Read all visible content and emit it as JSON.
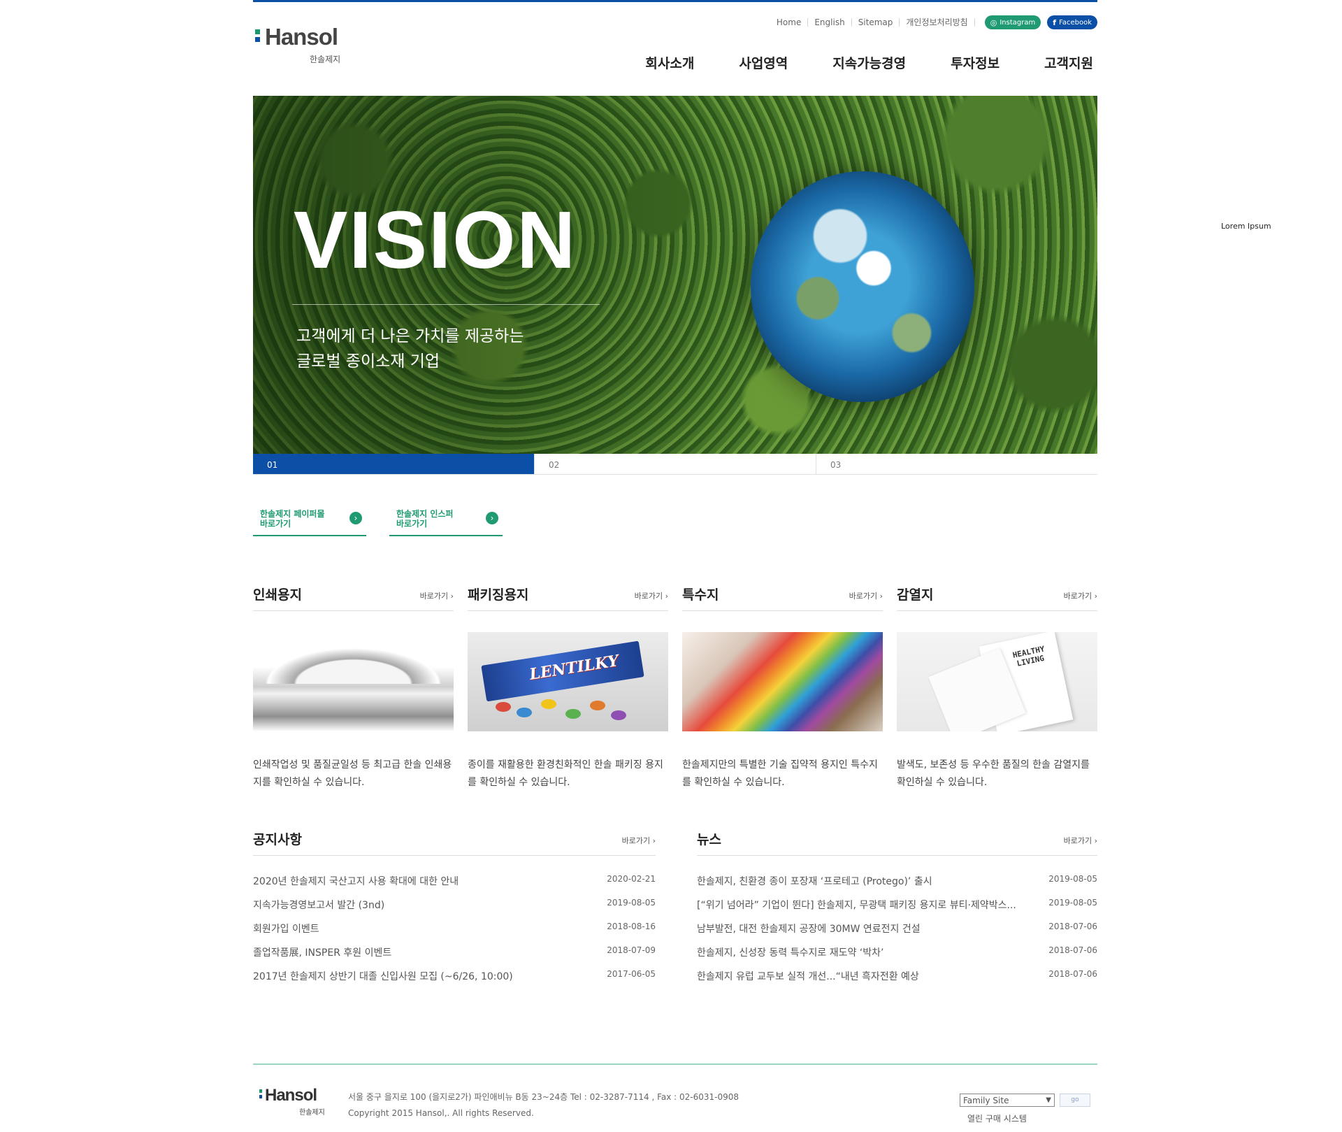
{
  "colors": {
    "brand_blue": "#0b4fa6",
    "brand_green": "#1f9a73",
    "instagram": "#1f9a73",
    "facebook": "#0b4fa6",
    "logo_green": "#1a9a6a",
    "logo_blue": "#0b4fa6"
  },
  "header": {
    "logo_word": "Hansol",
    "logo_sub": "한솔제지",
    "util_links": [
      "Home",
      "English",
      "Sitemap",
      "개인정보처리방침"
    ],
    "sns": {
      "instagram": "Instagram",
      "facebook": "Facebook",
      "instagram_icon": "instagram-icon",
      "facebook_icon": "facebook-icon"
    },
    "gnb": [
      "회사소개",
      "사업영역",
      "지속가능경영",
      "투자정보",
      "고객지원"
    ]
  },
  "hero": {
    "title": "VISION",
    "copy_line1": "고객에게 더 나은 가치를 제공하는",
    "copy_line2": "글로벌 종이소재 기업",
    "steps": [
      "01",
      "02",
      "03"
    ],
    "active_step": 1
  },
  "quick_links": [
    {
      "line1": "한솔제지 페이퍼몰",
      "line2": "바로가기",
      "icon": "arrow-right-icon"
    },
    {
      "line1": "한솔제지 인스퍼",
      "line2": "바로가기",
      "icon": "arrow-right-icon"
    }
  ],
  "products": [
    {
      "title": "인쇄용지",
      "more": "바로가기",
      "desc": "인쇄작업성 및 품질균일성 등 최고급 한솔 인쇄용지를 확인하실 수 있습니다."
    },
    {
      "title": "패키징용지",
      "more": "바로가기",
      "desc": "종이를 재활용한 환경친화적인 한솔 패키징 용지를 확인하실 수 있습니다.",
      "image_text": "LENTILKY"
    },
    {
      "title": "특수지",
      "more": "바로가기",
      "desc": "한솔제지만의 특별한 기술 집약적 용지인 특수지를 확인하실 수 있습니다."
    },
    {
      "title": "감열지",
      "more": "바로가기",
      "desc": "발색도, 보존성 등 우수한 품질의 한솔 감열지를 확인하실 수 있습니다.",
      "image_text": "HEALTHY LIVING"
    }
  ],
  "notice": {
    "title": "공지사항",
    "more": "바로가기",
    "items": [
      {
        "title": "2020년 한솔제지 국산고지 사용 확대에 대한 안내",
        "date": "2020-02-21"
      },
      {
        "title": "지속가능경영보고서 발간 (3nd)",
        "date": "2019-08-05"
      },
      {
        "title": "회원가입 이벤트",
        "date": "2018-08-16"
      },
      {
        "title": "졸업작품展, INSPER 후원 이벤트",
        "date": "2018-07-09"
      },
      {
        "title": "2017년 한솔제지 상반기 대졸 신입사원 모집 (~6/26, 10:00)",
        "date": "2017-06-05"
      }
    ]
  },
  "news": {
    "title": "뉴스",
    "more": "바로가기",
    "items": [
      {
        "title": "한솔제지, 친환경 종이 포장재 ‘프로테고 (Protego)’ 출시",
        "date": "2019-08-05"
      },
      {
        "title": "[“위기 넘어라” 기업이 뛴다] 한솔제지, 무광택 패키징 용지로 뷰티·제약박스...",
        "date": "2019-08-05"
      },
      {
        "title": "남부발전, 대전 한솔제지 공장에 30MW 연료전지 건설",
        "date": "2018-07-06"
      },
      {
        "title": "한솔제지, 신성장 동력 특수지로 재도약 ‘박차’",
        "date": "2018-07-06"
      },
      {
        "title": "한솔제지 유럽 교두보 실적 개선...“내년 흑자전환 예상",
        "date": "2018-07-06"
      }
    ]
  },
  "footer": {
    "logo_word": "Hansol",
    "logo_sub": "한솔제지",
    "address": "서울 중구 을지로 100 (을지로2가) 파인애비뉴 B동 23~24층 Tel : 02-3287-7114 , Fax : 02-6031-0908",
    "copyright": "Copyright 2015 Hansol,. All rights Reserved.",
    "family_select": "Family Site",
    "family_go": "go",
    "open_purchase": "열린 구매 시스템"
  },
  "side_note": "Lorem Ipsum"
}
